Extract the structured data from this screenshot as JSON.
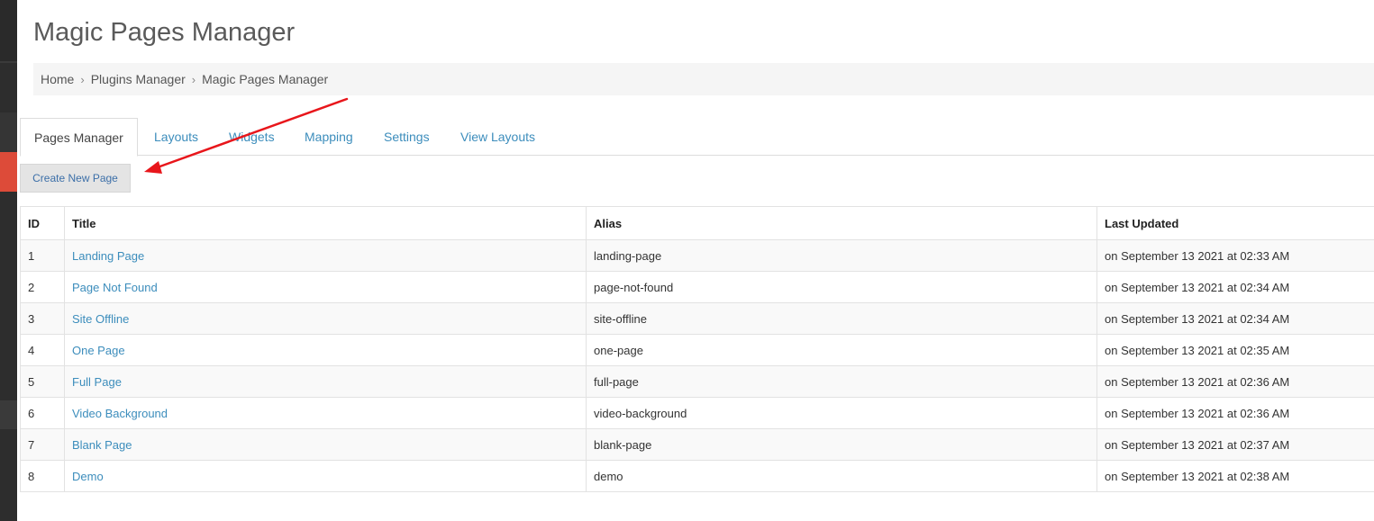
{
  "header": {
    "title": "Magic Pages Manager"
  },
  "breadcrumb": {
    "items": [
      "Home",
      "Plugins Manager",
      "Magic Pages Manager"
    ],
    "separator": "›"
  },
  "tabs": [
    {
      "label": "Pages Manager",
      "active": true
    },
    {
      "label": "Layouts",
      "active": false
    },
    {
      "label": "Widgets",
      "active": false
    },
    {
      "label": "Mapping",
      "active": false
    },
    {
      "label": "Settings",
      "active": false
    },
    {
      "label": "View Layouts",
      "active": false
    }
  ],
  "toolbar": {
    "create_label": "Create New Page"
  },
  "table": {
    "headers": [
      "ID",
      "Title",
      "Alias",
      "Last Updated"
    ],
    "rows": [
      {
        "id": "1",
        "title": "Landing Page",
        "alias": "landing-page",
        "updated": "on September 13 2021 at 02:33 AM"
      },
      {
        "id": "2",
        "title": "Page Not Found",
        "alias": "page-not-found",
        "updated": "on September 13 2021 at 02:34 AM"
      },
      {
        "id": "3",
        "title": "Site Offline",
        "alias": "site-offline",
        "updated": "on September 13 2021 at 02:34 AM"
      },
      {
        "id": "4",
        "title": "One Page",
        "alias": "one-page",
        "updated": "on September 13 2021 at 02:35 AM"
      },
      {
        "id": "5",
        "title": "Full Page",
        "alias": "full-page",
        "updated": "on September 13 2021 at 02:36 AM"
      },
      {
        "id": "6",
        "title": "Video Background",
        "alias": "video-background",
        "updated": "on September 13 2021 at 02:36 AM"
      },
      {
        "id": "7",
        "title": "Blank Page",
        "alias": "blank-page",
        "updated": "on September 13 2021 at 02:37 AM"
      },
      {
        "id": "8",
        "title": "Demo",
        "alias": "demo",
        "updated": "on September 13 2021 at 02:38 AM"
      }
    ]
  },
  "colors": {
    "link": "#3c8dbc",
    "sidebar": "#2d2d2d",
    "sidebar_active": "#dd4b39",
    "annotation_arrow": "#e8161b"
  },
  "icons": {
    "breadcrumb_separator": "chevron-right-icon",
    "annotation": "red-arrow-icon"
  }
}
